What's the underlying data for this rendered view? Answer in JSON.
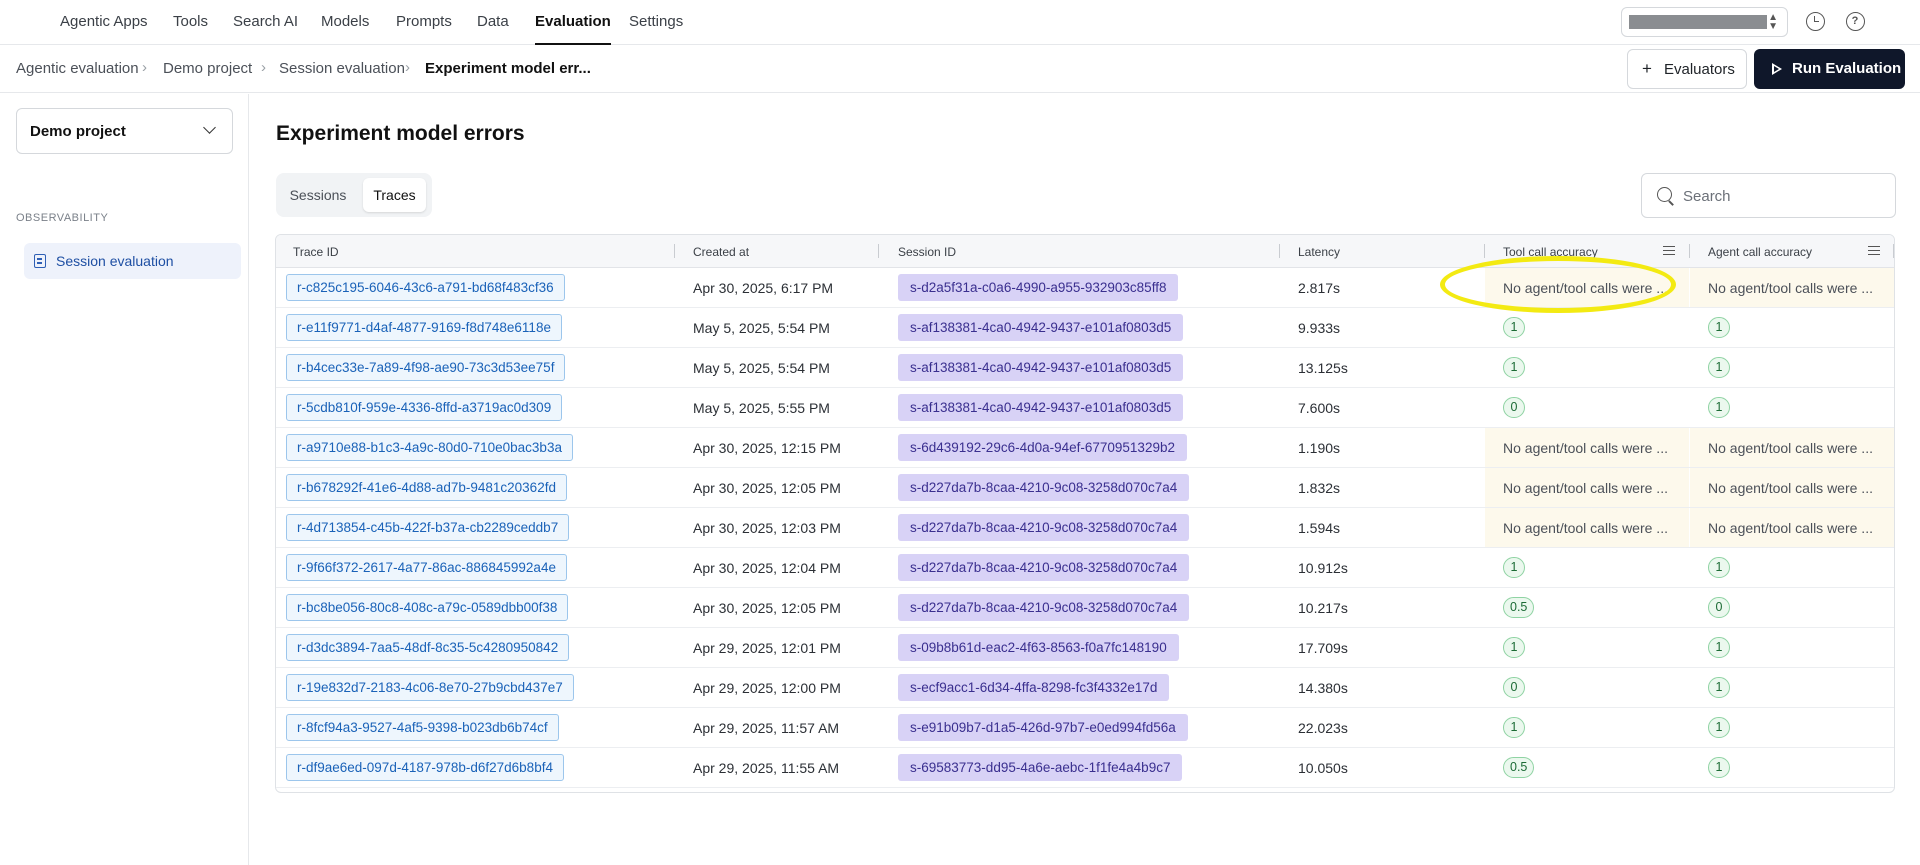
{
  "nav": {
    "tabs": [
      "Agentic Apps",
      "Tools",
      "Search AI",
      "Models",
      "Prompts",
      "Data",
      "Evaluation",
      "Settings"
    ],
    "active_tab": "Evaluation"
  },
  "icons": {
    "history": "clock-icon",
    "help": "help-icon",
    "help_glyph": "?",
    "search": "search-icon",
    "add": "plus-icon",
    "run": "play-icon",
    "project_dropdown": "chevron-down-icon",
    "sidebar_item": "document-icon",
    "column_menu": "menu-icon"
  },
  "breadcrumb": {
    "items": [
      "Agentic evaluation",
      "Demo project",
      "Session evaluation",
      "Experiment model err..."
    ],
    "separator": "›"
  },
  "actions": {
    "evaluators_label": "Evaluators",
    "evaluators_plus": "+",
    "run_label": "Run Evaluation"
  },
  "sidebar": {
    "project": "Demo project",
    "section_label": "OBSERVABILITY",
    "item_label": "Session evaluation"
  },
  "main": {
    "title": "Experiment model errors",
    "tabs": [
      "Sessions",
      "Traces"
    ],
    "active_tab": "Traces",
    "search_placeholder": "Search"
  },
  "table": {
    "columns": [
      "Trace ID",
      "Created at",
      "Session ID",
      "Latency",
      "Tool call accuracy",
      "Agent call accuracy"
    ],
    "rows": [
      {
        "trace": "r-c825c195-6046-43c6-a791-bd68f483cf36",
        "created": "Apr 30, 2025, 6:17 PM",
        "session": "s-d2a5f31a-c0a6-4990-a955-932903c85ff8",
        "latency": "2.817s",
        "tool": "No agent/tool calls were ...",
        "agent": "No agent/tool calls were ..."
      },
      {
        "trace": "r-e11f9771-d4af-4877-9169-f8d748e6118e",
        "created": "May 5, 2025, 5:54 PM",
        "session": "s-af138381-4ca0-4942-9437-e101af0803d5",
        "latency": "9.933s",
        "tool": "1",
        "agent": "1"
      },
      {
        "trace": "r-b4cec33e-7a89-4f98-ae90-73c3d53ee75f",
        "created": "May 5, 2025, 5:54 PM",
        "session": "s-af138381-4ca0-4942-9437-e101af0803d5",
        "latency": "13.125s",
        "tool": "1",
        "agent": "1"
      },
      {
        "trace": "r-5cdb810f-959e-4336-8ffd-a3719ac0d309",
        "created": "May 5, 2025, 5:55 PM",
        "session": "s-af138381-4ca0-4942-9437-e101af0803d5",
        "latency": "7.600s",
        "tool": "0",
        "agent": "1"
      },
      {
        "trace": "r-a9710e88-b1c3-4a9c-80d0-710e0bac3b3a",
        "created": "Apr 30, 2025, 12:15 PM",
        "session": "s-6d439192-29c6-4d0a-94ef-6770951329b2",
        "latency": "1.190s",
        "tool": "No agent/tool calls were ...",
        "agent": "No agent/tool calls were ..."
      },
      {
        "trace": "r-b678292f-41e6-4d88-ad7b-9481c20362fd",
        "created": "Apr 30, 2025, 12:05 PM",
        "session": "s-d227da7b-8caa-4210-9c08-3258d070c7a4",
        "latency": "1.832s",
        "tool": "No agent/tool calls were ...",
        "agent": "No agent/tool calls were ..."
      },
      {
        "trace": "r-4d713854-c45b-422f-b37a-cb2289ceddb7",
        "created": "Apr 30, 2025, 12:03 PM",
        "session": "s-d227da7b-8caa-4210-9c08-3258d070c7a4",
        "latency": "1.594s",
        "tool": "No agent/tool calls were ...",
        "agent": "No agent/tool calls were ..."
      },
      {
        "trace": "r-9f66f372-2617-4a77-86ac-886845992a4e",
        "created": "Apr 30, 2025, 12:04 PM",
        "session": "s-d227da7b-8caa-4210-9c08-3258d070c7a4",
        "latency": "10.912s",
        "tool": "1",
        "agent": "1"
      },
      {
        "trace": "r-bc8be056-80c8-408c-a79c-0589dbb00f38",
        "created": "Apr 30, 2025, 12:05 PM",
        "session": "s-d227da7b-8caa-4210-9c08-3258d070c7a4",
        "latency": "10.217s",
        "tool": "0.5",
        "agent": "0"
      },
      {
        "trace": "r-d3dc3894-7aa5-48df-8c35-5c4280950842",
        "created": "Apr 29, 2025, 12:01 PM",
        "session": "s-09b8b61d-eac2-4f63-8563-f0a7fc148190",
        "latency": "17.709s",
        "tool": "1",
        "agent": "1"
      },
      {
        "trace": "r-19e832d7-2183-4c06-8e70-27b9cbd437e7",
        "created": "Apr 29, 2025, 12:00 PM",
        "session": "s-ecf9acc1-6d34-4ffa-8298-fc3f4332e17d",
        "latency": "14.380s",
        "tool": "0",
        "agent": "1"
      },
      {
        "trace": "r-8fcf94a3-9527-4af5-9398-b023db6b74cf",
        "created": "Apr 29, 2025, 11:57 AM",
        "session": "s-e91b09b7-d1a5-426d-97b7-e0ed994fd56a",
        "latency": "22.023s",
        "tool": "1",
        "agent": "1"
      },
      {
        "trace": "r-df9ae6ed-097d-4187-978b-d6f27d6b8bf4",
        "created": "Apr 29, 2025, 11:55 AM",
        "session": "s-69583773-dd95-4a6e-aebc-1f1fe4a4b9c7",
        "latency": "10.050s",
        "tool": "0.5",
        "agent": "1"
      }
    ]
  },
  "colors": {
    "accent_dark": "#0f172a",
    "trace_chip": "#eef6fd",
    "session_chip": "#d8d2f6",
    "warn_cell": "#fdf9ec",
    "score_badge": "#ebf8ee",
    "highlight": "#f3ea12"
  }
}
